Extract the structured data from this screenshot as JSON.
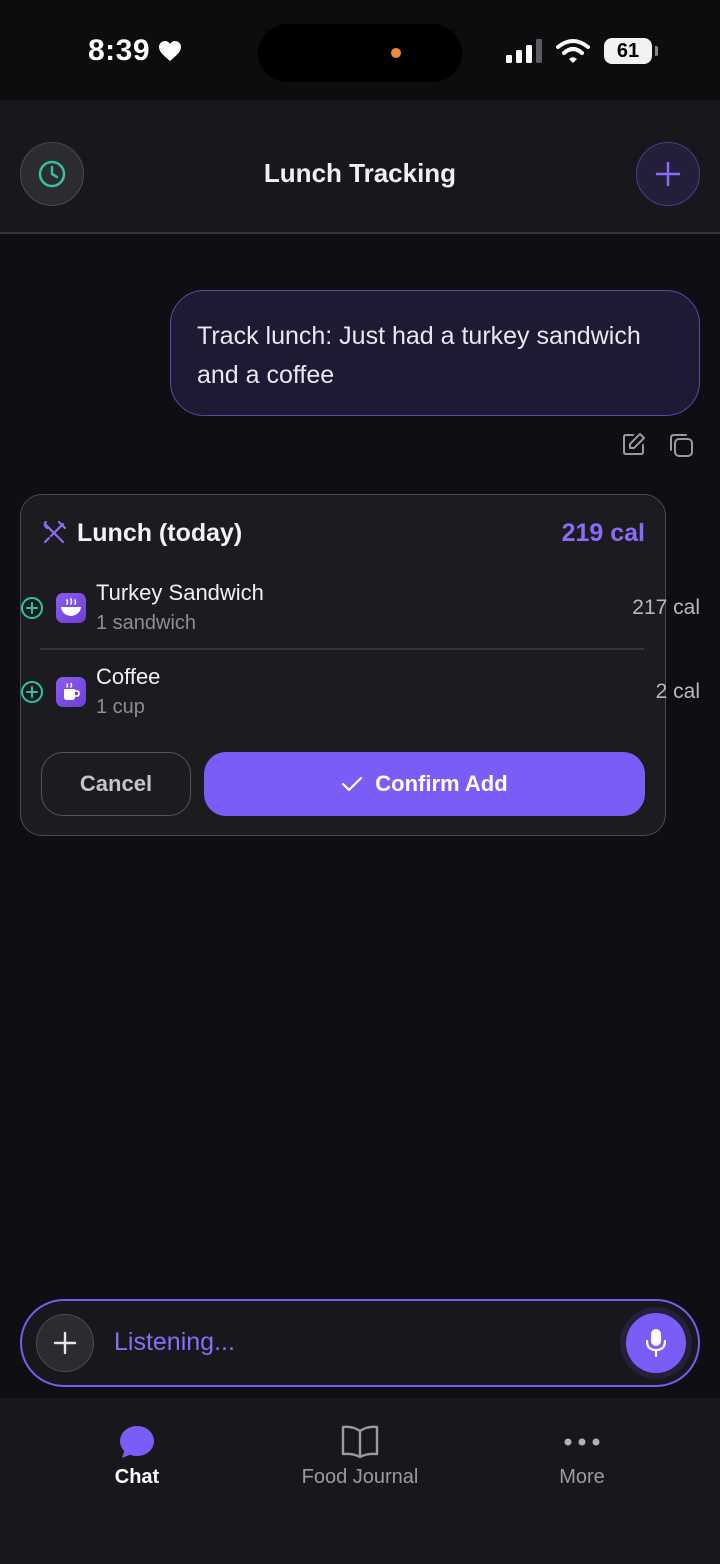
{
  "status_bar": {
    "time": "8:39",
    "battery": "61"
  },
  "header": {
    "title": "Lunch Tracking"
  },
  "user_message": {
    "text": "Track lunch: Just had a turkey sandwich and a coffee"
  },
  "meal_card": {
    "title": "Lunch (today)",
    "total": "219 cal",
    "items": [
      {
        "name": "Turkey Sandwich",
        "quantity": "1 sandwich",
        "calories": "217 cal",
        "icon": "bowl-icon"
      },
      {
        "name": "Coffee",
        "quantity": "1 cup",
        "calories": "2 cal",
        "icon": "coffee-cup-icon"
      }
    ],
    "cancel_label": "Cancel",
    "confirm_label": "Confirm Add"
  },
  "input_bar": {
    "text": "Listening..."
  },
  "tabs": [
    {
      "label": "Chat",
      "icon": "chat-bubble-icon",
      "active": true
    },
    {
      "label": "Food Journal",
      "icon": "open-book-icon",
      "active": false
    },
    {
      "label": "More",
      "icon": "more-dots-icon",
      "active": false
    }
  ],
  "colors": {
    "accent": "#7b5cf6",
    "accent_text": "#8b6cf7",
    "add_green": "#2fc3a2",
    "background": "#0e0e13"
  }
}
